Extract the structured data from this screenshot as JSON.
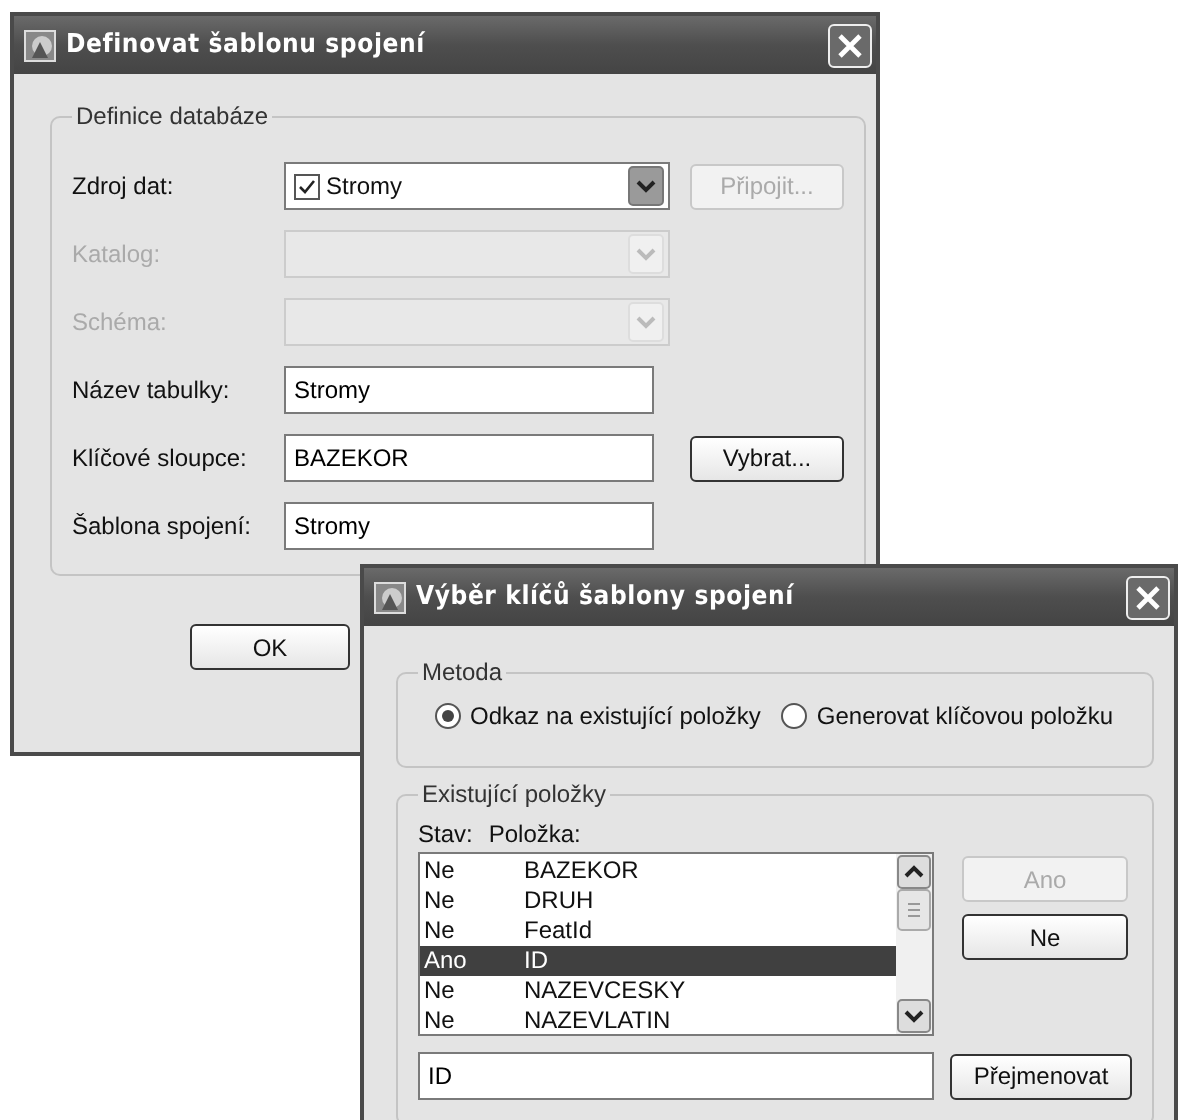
{
  "main_dialog": {
    "title": "Definovat šablonu spojení",
    "group_label": "Definice databáze",
    "rows": [
      {
        "kind": "combo",
        "label": "Zdroj dat:",
        "value": "Stromy",
        "checked": true,
        "disabled": false,
        "button": {
          "label": "Připojit...",
          "disabled": true
        }
      },
      {
        "kind": "combo",
        "label": "Katalog:",
        "disabled": true
      },
      {
        "kind": "combo",
        "label": "Schéma:",
        "disabled": true
      },
      {
        "kind": "field",
        "label": "Název tabulky:",
        "value": "Stromy"
      },
      {
        "kind": "field",
        "label": "Klíčové sloupce:",
        "value": "BAZEKOR",
        "button": {
          "label": "Vybrat...",
          "disabled": false
        }
      },
      {
        "kind": "field",
        "label": "Šablona spojení:",
        "value": "Stromy"
      }
    ],
    "buttons": [
      {
        "label": "OK"
      }
    ]
  },
  "key_dialog": {
    "title": "Výběr klíčů šablony spojení",
    "method_group": {
      "label": "Metoda",
      "options": [
        {
          "label": "Odkaz na existující položky",
          "selected": true
        },
        {
          "label": "Generovat klíčovou položku",
          "selected": false
        }
      ]
    },
    "items_group": {
      "label": "Existující položky",
      "columns": [
        "Stav:",
        "Položka:"
      ],
      "rows": [
        {
          "status": "Ne",
          "name": "BAZEKOR",
          "selected": false
        },
        {
          "status": "Ne",
          "name": "DRUH",
          "selected": false
        },
        {
          "status": "Ne",
          "name": "FeatId",
          "selected": false
        },
        {
          "status": "Ano",
          "name": "ID",
          "selected": true
        },
        {
          "status": "Ne",
          "name": "NAZEVCESKY",
          "selected": false
        },
        {
          "status": "Ne",
          "name": "NAZEVLATIN",
          "selected": false
        }
      ],
      "side_buttons": [
        {
          "label": "Ano",
          "disabled": true
        },
        {
          "label": "Ne",
          "disabled": false
        }
      ],
      "rename_field": {
        "value": "ID"
      },
      "rename_button": {
        "label": "Přejmenovat"
      }
    }
  }
}
